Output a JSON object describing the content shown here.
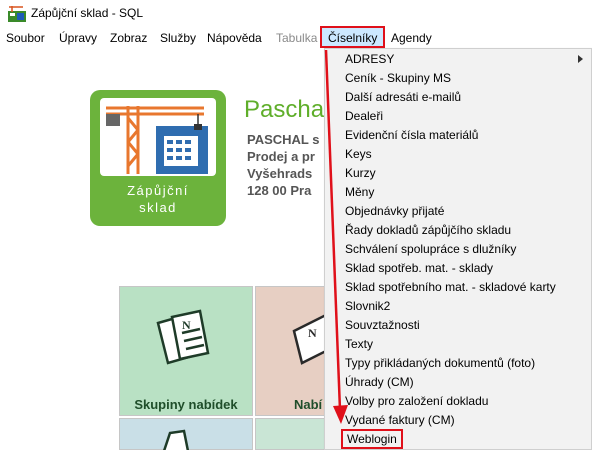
{
  "window": {
    "title": "Zápůjční sklad - SQL"
  },
  "menubar": {
    "items": [
      {
        "label": "Soubor"
      },
      {
        "label": "Úpravy"
      },
      {
        "label": "Zobraz"
      },
      {
        "label": "Služby"
      },
      {
        "label": "Nápověda"
      },
      {
        "label": "Tabulka"
      },
      {
        "label": "Číselníky"
      },
      {
        "label": "Agendy"
      }
    ]
  },
  "logo": {
    "caption_line1": "Zápůjční",
    "caption_line2": "sklad"
  },
  "company": {
    "name": "Paschal",
    "lines": [
      "PASCHAL  s",
      "Prodej a pr",
      "Vyšehrads",
      "128 00 Pra"
    ]
  },
  "tiles": [
    {
      "label": "Skupiny nabídek",
      "color": "#b9e1c4"
    },
    {
      "label": "Nabí",
      "color": "#e7cfc3"
    }
  ],
  "dropdown": {
    "items": [
      {
        "label": "ADRESY",
        "submenu": true
      },
      {
        "label": "Ceník - Skupiny MS"
      },
      {
        "label": "Další adresáti e-mailů"
      },
      {
        "label": "Dealeři"
      },
      {
        "label": "Evidenční čísla materiálů"
      },
      {
        "label": "Keys"
      },
      {
        "label": "Kurzy"
      },
      {
        "label": "Měny"
      },
      {
        "label": "Objednávky přijaté"
      },
      {
        "label": "Řady dokladů zápůjčího skladu"
      },
      {
        "label": "Schválení spolupráce s dlužníky"
      },
      {
        "label": "Sklad spotřeb. mat. - sklady"
      },
      {
        "label": "Sklad spotřebního mat. - skladové karty"
      },
      {
        "label": "Slovnik2"
      },
      {
        "label": "Souvztažnosti"
      },
      {
        "label": "Texty"
      },
      {
        "label": "Typy přikládaných dokumentů (foto)"
      },
      {
        "label": "Úhrady (CM)"
      },
      {
        "label": "Volby pro založení dokladu"
      },
      {
        "label": "Vydané faktury (CM)"
      },
      {
        "label": "Weblogin"
      }
    ]
  },
  "colors": {
    "annotation": "#e0101a",
    "brand_green": "#6cb33c",
    "menu_highlight": "#cce8ff"
  }
}
